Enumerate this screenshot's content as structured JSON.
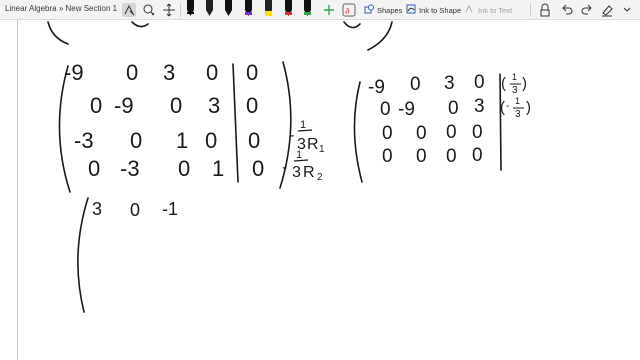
{
  "breadcrumb": "Linear Algebra » New Section 1",
  "toolbar": {
    "shapes_label": "Shapes",
    "ink_to_shape_label": "Ink to Shape",
    "ink_to_text_label": "Ink to Text"
  },
  "colors": {
    "toolbar_bg": "#f3f3f3",
    "ink": "#1a1a1a",
    "margin_line": "#f2b8b8",
    "pen_black": "#111111",
    "pen_purple": "#7a2bd1",
    "pen_magenta": "#d12fa0",
    "pen_yellow": "#f5e400",
    "pen_red": "#e32f2f",
    "pen_green": "#2fa84f"
  },
  "ink": {
    "matrix1": [
      [
        "-9",
        "0",
        "3",
        "0",
        "0"
      ],
      [
        "0",
        "-9",
        "0",
        "3",
        "0"
      ],
      [
        "-3",
        "0",
        "1",
        "0",
        "0"
      ],
      [
        "0",
        "-3",
        "0",
        "1",
        "0"
      ]
    ],
    "matrix2": [
      [
        "-9",
        "0",
        "3",
        "0"
      ],
      [
        "0",
        "-9",
        "0",
        "3"
      ],
      [
        "0",
        "0",
        "0",
        "0"
      ],
      [
        "0",
        "0",
        "0",
        "0"
      ]
    ],
    "ops_row3": [
      "-",
      "1",
      "3",
      "R",
      "1"
    ],
    "ops_row4": [
      "-",
      "1",
      "3",
      "R",
      "2"
    ],
    "scale_row1": [
      "(",
      "1",
      "3",
      ")"
    ],
    "scale_row2": [
      "(",
      "-",
      "1",
      "3",
      ")"
    ],
    "partial_row": [
      "3",
      "0",
      "-1"
    ]
  }
}
